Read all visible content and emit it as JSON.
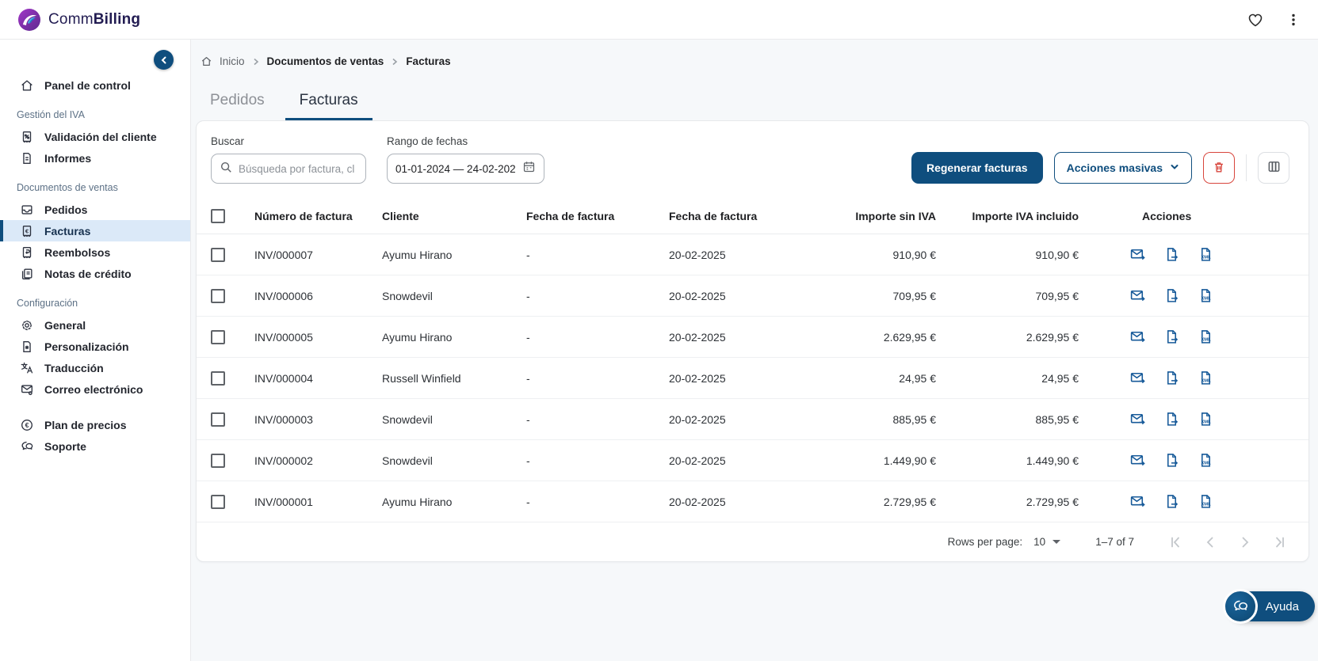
{
  "brand": {
    "prefix": "Comm",
    "suffix": "Billing"
  },
  "sidebar": {
    "dashboard": {
      "label": "Panel de control",
      "icon": "home-icon"
    },
    "groups": [
      {
        "title": "Gestión del IVA",
        "items": [
          {
            "label": "Validación del cliente",
            "icon": "receipt-percent-icon"
          },
          {
            "label": "Informes",
            "icon": "report-icon"
          }
        ]
      },
      {
        "title": "Documentos de ventas",
        "items": [
          {
            "label": "Pedidos",
            "icon": "orders-icon"
          },
          {
            "label": "Facturas",
            "icon": "invoice-icon",
            "active": true
          },
          {
            "label": "Reembolsos",
            "icon": "refund-icon"
          },
          {
            "label": "Notas de crédito",
            "icon": "credit-note-icon"
          }
        ]
      },
      {
        "title": "Configuración",
        "items": [
          {
            "label": "General",
            "icon": "gear-icon"
          },
          {
            "label": "Personalización",
            "icon": "customize-icon"
          },
          {
            "label": "Traducción",
            "icon": "translate-icon"
          },
          {
            "label": "Correo electrónico",
            "icon": "mail-settings-icon"
          }
        ]
      }
    ],
    "footer_items": [
      {
        "label": "Plan de precios",
        "icon": "euro-circle-icon"
      },
      {
        "label": "Soporte",
        "icon": "support-chat-icon"
      }
    ]
  },
  "breadcrumb": {
    "items": [
      "Inicio",
      "Documentos de ventas",
      "Facturas"
    ]
  },
  "tabs": [
    {
      "label": "Pedidos",
      "active": false
    },
    {
      "label": "Facturas",
      "active": true
    }
  ],
  "filters": {
    "search_label": "Buscar",
    "search_placeholder": "Búsqueda por factura, cl",
    "date_label": "Rango de fechas",
    "date_value": "01-01-2024 — 24-02-202"
  },
  "toolbar": {
    "regenerate_label": "Regenerar facturas",
    "bulk_actions_label": "Acciones masivas"
  },
  "table": {
    "headers": [
      "Número de factura",
      "Cliente",
      "Fecha de factura",
      "Fecha de factura",
      "Importe sin IVA",
      "Importe IVA incluido",
      "Acciones"
    ],
    "rows": [
      {
        "number": "INV/000007",
        "client": "Ayumu Hirano",
        "invoice_date": "-",
        "invoice_date_2": "20-02-2025",
        "net": "910,90 €",
        "total": "910,90 €"
      },
      {
        "number": "INV/000006",
        "client": "Snowdevil",
        "invoice_date": "-",
        "invoice_date_2": "20-02-2025",
        "net": "709,95 €",
        "total": "709,95 €"
      },
      {
        "number": "INV/000005",
        "client": "Ayumu Hirano",
        "invoice_date": "-",
        "invoice_date_2": "20-02-2025",
        "net": "2.629,95 €",
        "total": "2.629,95 €"
      },
      {
        "number": "INV/000004",
        "client": "Russell Winfield",
        "invoice_date": "-",
        "invoice_date_2": "20-02-2025",
        "net": "24,95 €",
        "total": "24,95 €"
      },
      {
        "number": "INV/000003",
        "client": "Snowdevil",
        "invoice_date": "-",
        "invoice_date_2": "20-02-2025",
        "net": "885,95 €",
        "total": "885,95 €"
      },
      {
        "number": "INV/000002",
        "client": "Snowdevil",
        "invoice_date": "-",
        "invoice_date_2": "20-02-2025",
        "net": "1.449,90 €",
        "total": "1.449,90 €"
      },
      {
        "number": "INV/000001",
        "client": "Ayumu Hirano",
        "invoice_date": "-",
        "invoice_date_2": "20-02-2025",
        "net": "2.729,95 €",
        "total": "2.729,95 €"
      }
    ]
  },
  "pagination": {
    "rows_per_page_label": "Rows per page:",
    "rows_per_page": "10",
    "range": "1–7 of 7"
  },
  "help": {
    "label": "Ayuda"
  },
  "colors": {
    "primary": "#0F4E7E",
    "danger": "#D8453C",
    "active_item_bg": "#DBE9F8",
    "brand_text": "#221C52"
  }
}
